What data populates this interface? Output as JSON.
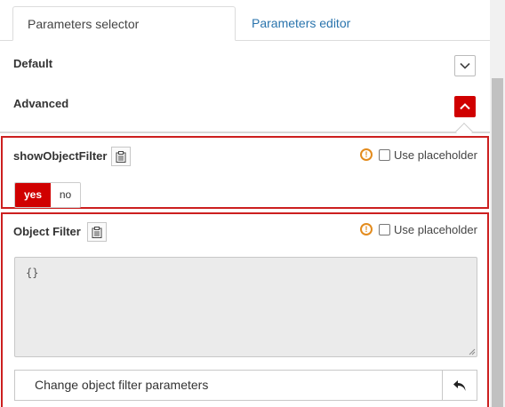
{
  "tabs": [
    {
      "label": "Parameters selector",
      "active": true
    },
    {
      "label": "Parameters editor",
      "active": false
    }
  ],
  "sections": {
    "default_label": "Default",
    "advanced_label": "Advanced"
  },
  "params": [
    {
      "name": "showObjectFilter",
      "placeholder_label": "Use placeholder",
      "yes_label": "yes",
      "no_label": "no",
      "selected": "yes"
    },
    {
      "name": "Object Filter",
      "placeholder_label": "Use placeholder",
      "value": "{}",
      "action_label": "Change object filter parameters"
    }
  ],
  "colors": {
    "accent": "#d00000",
    "border_highlight": "#cc1f1f",
    "link": "#2a74ad",
    "warning": "#e38b1d"
  },
  "icons": {
    "collapsed_toggle": "chevron-down-icon",
    "expanded_toggle": "chevron-up-icon",
    "clipboard": "clipboard-icon",
    "warning": "warning-icon",
    "undo": "undo-icon"
  }
}
